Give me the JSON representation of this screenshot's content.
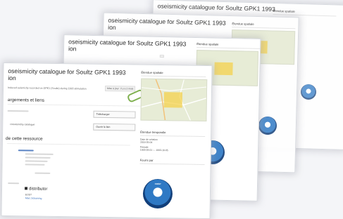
{
  "pages": {
    "back1": {
      "title": "oseismicity catalogue for Soultz GPK1 1993",
      "spatial_heading": "Étendue spatiale"
    },
    "back2": {
      "title": "oseismicity catalogue for Soultz GPK1 1993",
      "subtitle": "ion",
      "spatial_heading": "Étendue spatiale"
    },
    "back3": {
      "title": "oseismicity catalogue for Soultz GPK1 1993",
      "subtitle": "ion",
      "spatial_heading": "Étendue spatiale"
    },
    "front": {
      "title": "oseismicity catalogue for Soultz GPK1 1993",
      "title_line2": "ion",
      "description": "Induced seismicity recorded on GPK1 (Soultz) during 1993 stimulation",
      "version_badge": "Mise à jour : il y a 2 mois",
      "section_downloads": "argements et liens",
      "download_button": "Télécharger",
      "catalogue_item": "croseismicity catalogue",
      "open_link_button": "Ouvrir le lien",
      "section_about": "de cette ressource",
      "distributor_heading": "distributor",
      "distributor_org": "EOST",
      "distributor_contact": "Marc Schaming",
      "spatial_heading": "Étendue spatiale",
      "temporal_heading": "Étendue temporelle",
      "creation_label": "Date de création",
      "creation_value": "2016-05-04",
      "period_label": "Période",
      "period_value": "1993-09-01 — 1993-10-05",
      "providers_heading": "Fourni par",
      "logo_text": "CDGP"
    }
  }
}
